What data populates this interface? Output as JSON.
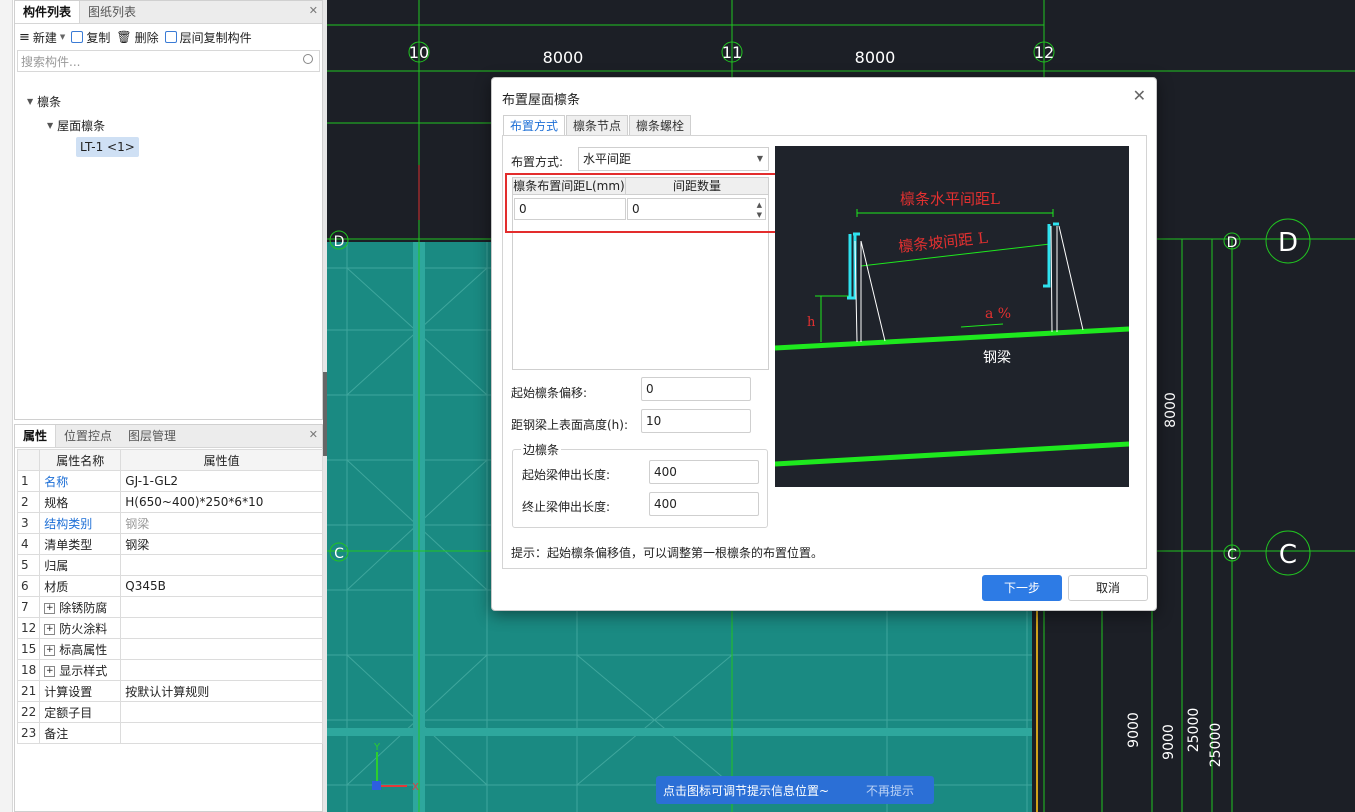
{
  "component_panel": {
    "tabs": [
      "构件列表",
      "图纸列表"
    ],
    "toolbar": {
      "new": "新建",
      "copy": "复制",
      "delete": "删除",
      "floor_copy": "层间复制构件"
    },
    "search_placeholder": "搜索构件...",
    "tree": {
      "root": "檩条",
      "child": "屋面檩条",
      "leaf": "LT-1 <1>"
    }
  },
  "property_panel": {
    "tabs": [
      "属性",
      "位置控点",
      "图层管理"
    ],
    "headers": {
      "name": "属性名称",
      "value": "属性值"
    },
    "rows": [
      {
        "no": "1",
        "name": "名称",
        "value": "GJ-1-GL2"
      },
      {
        "no": "2",
        "name": "规格",
        "value": "H(650~400)*250*6*10"
      },
      {
        "no": "3",
        "name": "结构类别",
        "value": "钢梁"
      },
      {
        "no": "4",
        "name": "清单类型",
        "value": "钢梁"
      },
      {
        "no": "5",
        "name": "归属",
        "value": ""
      },
      {
        "no": "6",
        "name": "材质",
        "value": "Q345B"
      },
      {
        "no": "7",
        "name": "除锈防腐",
        "value": ""
      },
      {
        "no": "12",
        "name": "防火涂料",
        "value": ""
      },
      {
        "no": "15",
        "name": "标高属性",
        "value": ""
      },
      {
        "no": "18",
        "name": "显示样式",
        "value": ""
      },
      {
        "no": "21",
        "name": "计算设置",
        "value": "按默认计算规则"
      },
      {
        "no": "22",
        "name": "定额子目",
        "value": ""
      },
      {
        "no": "23",
        "name": "备注",
        "value": ""
      }
    ]
  },
  "canvas": {
    "axis_top": [
      "10",
      "11",
      "12"
    ],
    "dims_top": [
      "8000",
      "8000"
    ],
    "axis_right": [
      "D",
      "C"
    ],
    "dims_right": [
      "8000",
      "9000",
      "9000",
      "25000",
      "25000"
    ],
    "ucs": {
      "x": "X",
      "y": "Y"
    }
  },
  "dialog": {
    "title": "布置屋面檩条",
    "tabs": [
      "布置方式",
      "檩条节点",
      "檩条螺栓"
    ],
    "layout_label": "布置方式:",
    "layout_value": "水平间距",
    "grid_headers": [
      "檩条布置间距L(mm)",
      "间距数量"
    ],
    "grid_values": [
      "0",
      "0"
    ],
    "start_offset_label": "起始檩条偏移:",
    "start_offset_value": "0",
    "height_label": "距钢梁上表面高度(h):",
    "height_value": "10",
    "edge_group": "边檩条",
    "start_ext_label": "起始梁伸出长度:",
    "start_ext_value": "400",
    "end_ext_label": "终止梁伸出长度:",
    "end_ext_value": "400",
    "preview": {
      "horizontal": "檩条水平间距L",
      "slope": "檩条坡间距 L",
      "pct": "a %",
      "h": "h",
      "beam": "钢梁"
    },
    "hint": "提示：起始檩条偏移值，可以调整第一根檩条的布置位置。",
    "next": "下一步",
    "cancel": "取消"
  },
  "tipbar": {
    "text": "点击图标可调节提示信息位置~",
    "dismiss": "不再提示"
  }
}
